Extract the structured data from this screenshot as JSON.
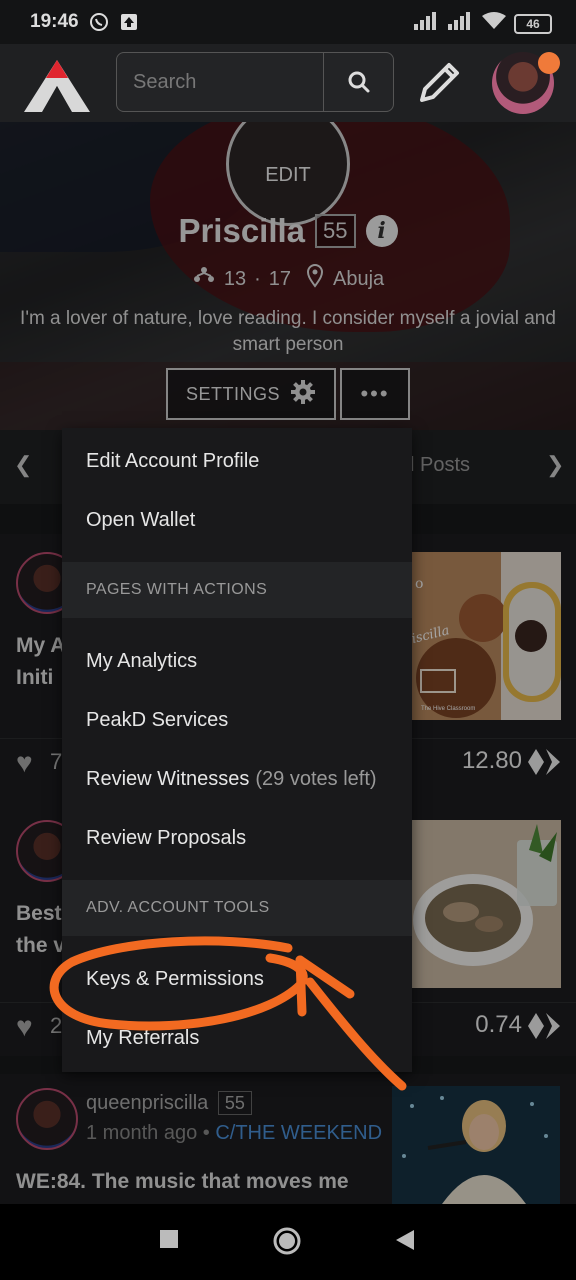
{
  "status_bar": {
    "time": "19:46",
    "battery": "46"
  },
  "header": {
    "search_placeholder": "Search"
  },
  "profile": {
    "avatar_edit_label": "EDIT",
    "name": "Priscilla",
    "reputation": "55",
    "followers": "13",
    "following": "17",
    "location": "Abuja",
    "bio": "I'm a lover of nature, love reading. I consider myself a jovial and smart person",
    "settings_label": "SETTINGS",
    "more_label": "•••"
  },
  "tabs": {
    "visible_label": "l Posts"
  },
  "menu": {
    "items_top": [
      "Edit Account Profile",
      "Open Wallet"
    ],
    "section1": "PAGES WITH ACTIONS",
    "items_mid": [
      "My Analytics",
      "PeakD Services",
      "Review Witnesses",
      "Review Proposals"
    ],
    "witness_votes_left": "(29 votes left)",
    "section2": "ADV. ACCOUNT TOOLS",
    "items_bottom": [
      "Keys & Permissions",
      "My Referrals"
    ]
  },
  "feed": {
    "posts": [
      {
        "title_line1": "My A",
        "title_line2": "Initi",
        "votes": "7",
        "payout": "12.80"
      },
      {
        "title_line1": "Best",
        "title_line2": "the v",
        "votes": "2",
        "payout": "0.74"
      },
      {
        "author": "queenpriscilla",
        "reputation": "55",
        "time_ago": "1 month ago",
        "separator": "•",
        "community": "C/THE WEEKEND",
        "title": "WE:84. The music that moves me"
      }
    ],
    "thumb1_text": {
      "line1": "o",
      "line2": "iscilla",
      "caption": "The Hive Classroom"
    }
  },
  "colors": {
    "accent_orange": "#f26a21",
    "community_blue": "#4a8fd8",
    "logo_red": "#e0262f"
  }
}
